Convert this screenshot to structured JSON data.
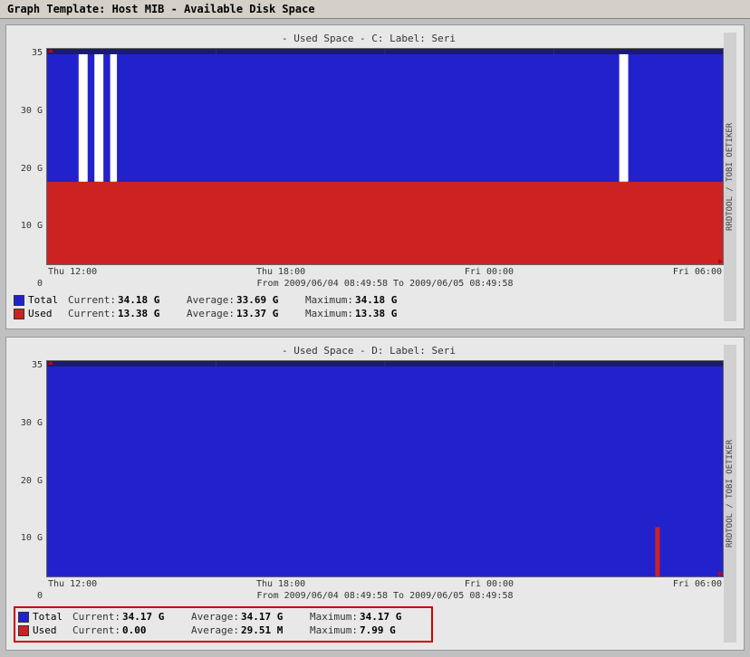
{
  "title": "Graph Template: Host MIB - Available Disk Space",
  "graphs": [
    {
      "id": "graph-c",
      "title": "- Used Space - C: Label:  Seri",
      "y_labels": [
        "30 G",
        "20 G",
        "10 G",
        "0"
      ],
      "x_labels": [
        "Thu 12:00",
        "Thu 18:00",
        "Fri 00:00",
        "Fri 06:00"
      ],
      "date_range": "From 2009/06/04 08:49:58 To 2009/06/05 08:49:58",
      "side_text": "RRDTOOL / TOBI OETIKER",
      "legend": [
        {
          "color": "#1a1aee",
          "label": "Total",
          "current_key": "Current:",
          "current_val": "34.18 G",
          "avg_key": "Average:",
          "avg_val": "33.69 G",
          "max_key": "Maximum:",
          "max_val": "34.18 G",
          "highlighted": false
        },
        {
          "color": "#cc0000",
          "label": "Used",
          "current_key": "Current:",
          "current_val": "13.38 G",
          "avg_key": "Average:",
          "avg_val": "13.37 G",
          "max_key": "Maximum:",
          "max_val": "13.38 G",
          "highlighted": false
        }
      ]
    },
    {
      "id": "graph-d",
      "title": "- Used Space - D: Label:  Seri",
      "y_labels": [
        "30 G",
        "20 G",
        "10 G",
        "0"
      ],
      "x_labels": [
        "Thu 12:00",
        "Thu 18:00",
        "Fri 00:00",
        "Fri 06:00"
      ],
      "date_range": "From 2009/06/04 08:49:58 To 2009/06/05 08:49:58",
      "side_text": "RRDTOOL / TOBI OETIKER",
      "legend": [
        {
          "color": "#1a1aee",
          "label": "Total",
          "current_key": "Current:",
          "current_val": "34.17 G",
          "avg_key": "Average:",
          "avg_val": "34.17 G",
          "max_key": "Maximum:",
          "max_val": "34.17 G",
          "highlighted": false
        },
        {
          "color": "#cc0000",
          "label": "Used",
          "current_key": "Current:",
          "current_val": "0.00",
          "avg_key": "Average:",
          "avg_val": "29.51 M",
          "max_key": "Maximum:",
          "max_val": "7.99 G",
          "highlighted": true
        }
      ]
    }
  ]
}
